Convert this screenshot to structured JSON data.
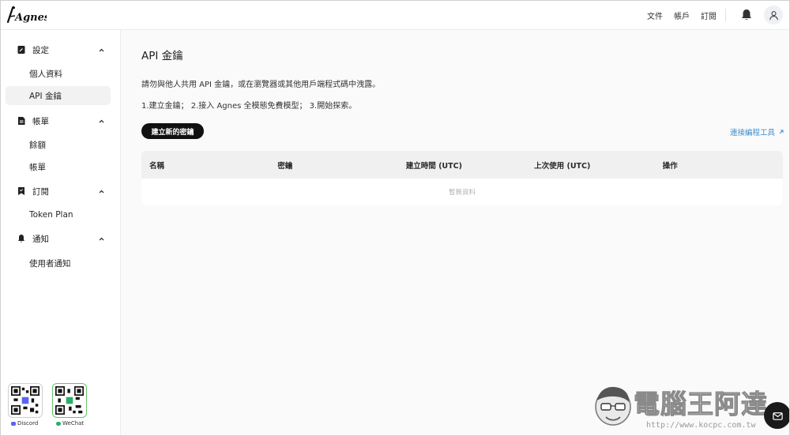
{
  "brand": {
    "logo_text": "Agnes"
  },
  "header": {
    "nav": [
      "文件",
      "帳戶",
      "訂閱"
    ]
  },
  "sidebar": {
    "groups": [
      {
        "label": "設定",
        "icon": "edit-note-icon",
        "items": [
          {
            "label": "個人資料",
            "active": false
          },
          {
            "label": "API 金鑰",
            "active": true
          }
        ]
      },
      {
        "label": "帳單",
        "icon": "document-icon",
        "items": [
          {
            "label": "餘額",
            "active": false
          },
          {
            "label": "帳單",
            "active": false
          }
        ]
      },
      {
        "label": "訂閱",
        "icon": "bookmark-icon",
        "items": [
          {
            "label": "Token Plan",
            "active": false
          }
        ]
      },
      {
        "label": "通知",
        "icon": "bell-icon",
        "items": [
          {
            "label": "使用者通知",
            "active": false
          }
        ]
      }
    ],
    "qr": [
      {
        "label": "Discord",
        "icon": "discord-icon"
      },
      {
        "label": "WeChat",
        "icon": "wechat-icon"
      }
    ]
  },
  "main": {
    "title": "API 金鑰",
    "description": "請勿與他人共用 API 金鑰，或在瀏覽器或其他用戶端程式碼中洩露。",
    "steps": "1.建立金鑰； 2.接入 Agnes 全模態免費模型； 3.開始探索。",
    "create_button": "建立新的密鑰",
    "connect_link": "連接編程工具",
    "table": {
      "columns": [
        "名稱",
        "密鑰",
        "建立時間 (UTC)",
        "上次使用 (UTC)",
        "操作"
      ],
      "empty_text": "暫無資料"
    }
  },
  "watermark": {
    "text": "電腦王阿達",
    "url": "http://www.kocpc.com.tw"
  },
  "colors": {
    "accent_link": "#3e8ed0",
    "primary_button": "#111111",
    "active_item_bg": "#f2f2f2"
  }
}
